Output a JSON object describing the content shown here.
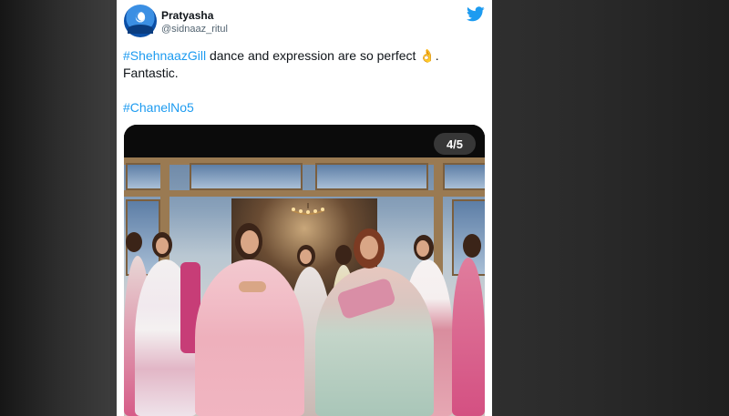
{
  "tweet": {
    "user_name": "Pratyasha",
    "user_handle": "@sidnaaz_ritul",
    "hashtag_1": "#ShehnaazGill",
    "text_line_1": " dance and expression are so perfect ",
    "emoji": "👌",
    "text_end": ".",
    "text_line_2": "Fantastic.",
    "hashtag_2": "#ChanelNo5"
  },
  "media": {
    "counter": "4/5",
    "description_icon": "video-frame"
  },
  "icons": {
    "brand": "twitter-bird-icon",
    "avatar": "avatar-moon"
  },
  "colors": {
    "hashtag": "#1d9bf0",
    "twitter_blue": "#1d9bf0",
    "name": "#0f1419",
    "handle": "#536471"
  }
}
